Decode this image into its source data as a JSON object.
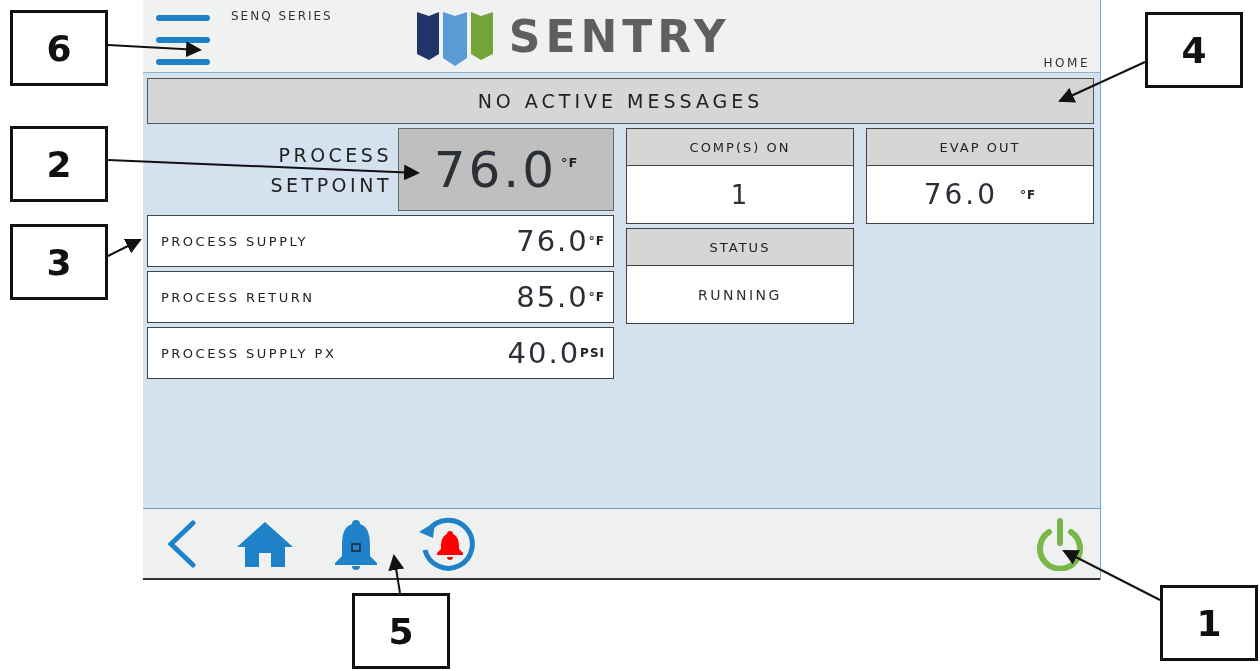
{
  "header": {
    "series": "SENQ SERIES",
    "brand": "SENTRY",
    "page": "HOME"
  },
  "message_bar": {
    "text": "NO ACTIVE MESSAGES"
  },
  "setpoint": {
    "label": "PROCESS SETPOINT",
    "value": "76.0",
    "unit": "°F"
  },
  "readings": [
    {
      "label": "PROCESS SUPPLY",
      "value": "76.0",
      "unit": "°F"
    },
    {
      "label": "PROCESS RETURN",
      "value": "85.0",
      "unit": "°F"
    },
    {
      "label": "PROCESS SUPPLY PX",
      "value": "40.0",
      "unit": "PSI"
    }
  ],
  "cards": [
    {
      "title": "COMP(S) ON",
      "value": "1"
    },
    {
      "title": "EVAP OUT",
      "value": "76.0",
      "unit": "°F"
    },
    {
      "title": "STATUS",
      "value": "RUNNING"
    }
  ],
  "nav": [
    {
      "kind": "back"
    },
    {
      "kind": "home"
    },
    {
      "kind": "alarm"
    },
    {
      "kind": "alarm-reset"
    },
    {
      "kind": "power"
    }
  ],
  "callouts": [
    "6",
    "2",
    "3",
    "4",
    "5",
    "1"
  ]
}
